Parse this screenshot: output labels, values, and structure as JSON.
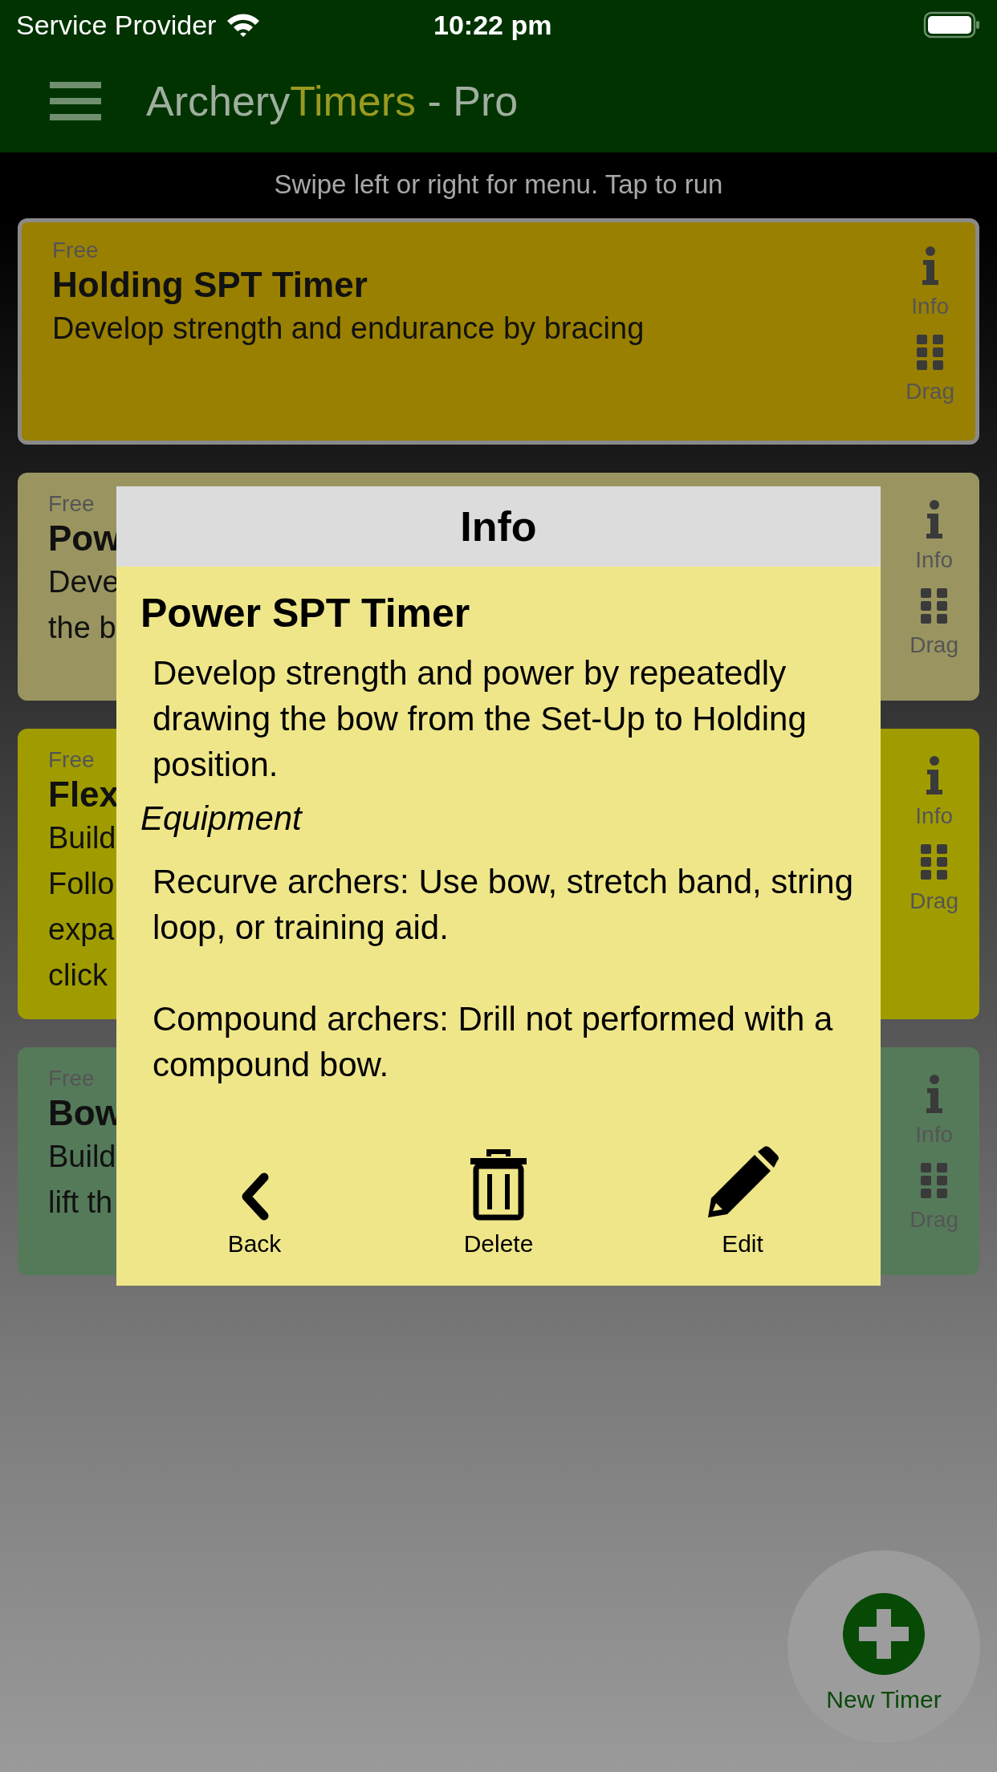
{
  "status_bar": {
    "carrier": "Service Provider",
    "time": "10:22 pm"
  },
  "header": {
    "title_parts": [
      {
        "kind": "plain",
        "text": "Archery"
      },
      {
        "kind": "accent",
        "text": "Timers"
      },
      {
        "kind": "plain",
        "text": " - Pro"
      }
    ]
  },
  "hint": "Swipe left or right for menu. Tap to run",
  "cards": [
    {
      "tier": "Free",
      "title": "Holding SPT Timer",
      "description": [
        "Develop strength and endurance by bracing"
      ],
      "selected": true,
      "color": "#9a8000",
      "info_label": "Info",
      "drag_label": "Drag"
    },
    {
      "tier": "Free",
      "title": "Pow",
      "description": [
        "Deve",
        "the b"
      ],
      "selected": false,
      "color": "#9a9560",
      "info_label": "Info",
      "drag_label": "Drag"
    },
    {
      "tier": "Free",
      "title": "Flex",
      "description": [
        "Build",
        "Follo",
        "expa",
        "click"
      ],
      "selected": false,
      "color": "#a09c00",
      "info_label": "Info",
      "drag_label": "Drag"
    },
    {
      "tier": "Free",
      "title": "Bow",
      "description": [
        "Build",
        "lift th"
      ],
      "selected": false,
      "color": "#557a5a",
      "info_label": "Info",
      "drag_label": "Drag"
    }
  ],
  "dialog": {
    "title": "Info",
    "heading": "Power SPT Timer",
    "description": "Develop strength and power by repeatedly drawing the bow from the Set-Up to Holding position.",
    "section_title": "Equipment",
    "paragraphs": [
      "Recurve archers: Use bow, stretch band, string loop, or training aid.",
      "Compound archers: Drill not performed with a compound bow."
    ],
    "actions": [
      {
        "kind": "back",
        "label": "Back"
      },
      {
        "kind": "delete",
        "label": "Delete"
      },
      {
        "kind": "edit",
        "label": "Edit"
      }
    ]
  },
  "fab": {
    "label": "New Timer"
  }
}
